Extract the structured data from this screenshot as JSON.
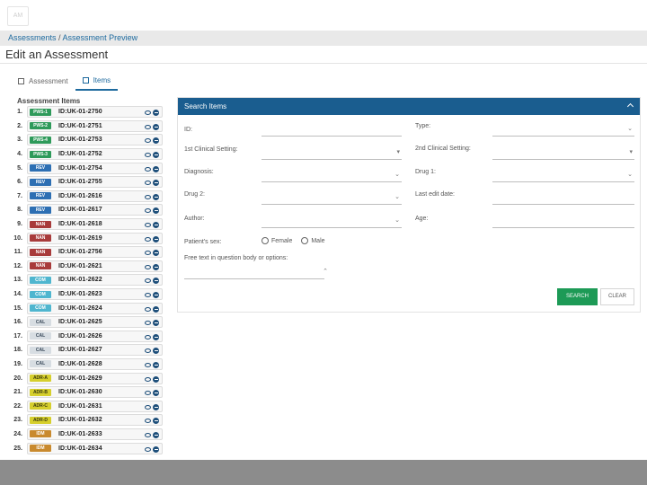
{
  "app": {
    "logo_text": "AM"
  },
  "breadcrumb": {
    "link1": "Assessments",
    "separator": " / ",
    "link2": "Assessment Preview"
  },
  "page": {
    "title": "Edit an Assessment"
  },
  "tabs": [
    {
      "label": "Assessment",
      "active": false
    },
    {
      "label": "Items",
      "active": true
    }
  ],
  "items_header": "Assessment Items",
  "tag_colors": {
    "PWS": "#2e9a5a",
    "REV": "#2d6fb3",
    "NAN": "#a83b3b",
    "COM": "#4fb6cf",
    "CAL": "#d7dde2",
    "ADR": "#d6cf2d",
    "IDM": "#c98a2e"
  },
  "items": [
    {
      "num": "1.",
      "tag": "PWS-1",
      "tag_type": "PWS",
      "id": "ID:UK-01-2750"
    },
    {
      "num": "2.",
      "tag": "PWS-2",
      "tag_type": "PWS",
      "id": "ID:UK-01-2751"
    },
    {
      "num": "3.",
      "tag": "PWS-4",
      "tag_type": "PWS",
      "id": "ID:UK-01-2753"
    },
    {
      "num": "4.",
      "tag": "PWS-3",
      "tag_type": "PWS",
      "id": "ID:UK-01-2752"
    },
    {
      "num": "5.",
      "tag": "REV",
      "tag_type": "REV",
      "id": "ID:UK-01-2754"
    },
    {
      "num": "6.",
      "tag": "REV",
      "tag_type": "REV",
      "id": "ID:UK-01-2755"
    },
    {
      "num": "7.",
      "tag": "REV",
      "tag_type": "REV",
      "id": "ID:UK-01-2616"
    },
    {
      "num": "8.",
      "tag": "REV",
      "tag_type": "REV",
      "id": "ID:UK-01-2617"
    },
    {
      "num": "9.",
      "tag": "NAN",
      "tag_type": "NAN",
      "id": "ID:UK-01-2618"
    },
    {
      "num": "10.",
      "tag": "NAN",
      "tag_type": "NAN",
      "id": "ID:UK-01-2619"
    },
    {
      "num": "11.",
      "tag": "NAN",
      "tag_type": "NAN",
      "id": "ID:UK-01-2756"
    },
    {
      "num": "12.",
      "tag": "NAN",
      "tag_type": "NAN",
      "id": "ID:UK-01-2621"
    },
    {
      "num": "13.",
      "tag": "COM",
      "tag_type": "COM",
      "id": "ID:UK-01-2622"
    },
    {
      "num": "14.",
      "tag": "COM",
      "tag_type": "COM",
      "id": "ID:UK-01-2623"
    },
    {
      "num": "15.",
      "tag": "COM",
      "tag_type": "COM",
      "id": "ID:UK-01-2624"
    },
    {
      "num": "16.",
      "tag": "CAL",
      "tag_type": "CAL",
      "id": "ID:UK-01-2625"
    },
    {
      "num": "17.",
      "tag": "CAL",
      "tag_type": "CAL",
      "id": "ID:UK-01-2626"
    },
    {
      "num": "18.",
      "tag": "CAL",
      "tag_type": "CAL",
      "id": "ID:UK-01-2627"
    },
    {
      "num": "19.",
      "tag": "CAL",
      "tag_type": "CAL",
      "id": "ID:UK-01-2628"
    },
    {
      "num": "20.",
      "tag": "ADR-A",
      "tag_type": "ADR",
      "id": "ID:UK-01-2629"
    },
    {
      "num": "21.",
      "tag": "ADR-B",
      "tag_type": "ADR",
      "id": "ID:UK-01-2630"
    },
    {
      "num": "22.",
      "tag": "ADR-C",
      "tag_type": "ADR",
      "id": "ID:UK-01-2631"
    },
    {
      "num": "23.",
      "tag": "ADR-D",
      "tag_type": "ADR",
      "id": "ID:UK-01-2632"
    },
    {
      "num": "24.",
      "tag": "IDM",
      "tag_type": "IDM",
      "id": "ID:UK-01-2633"
    },
    {
      "num": "25.",
      "tag": "IDM",
      "tag_type": "IDM",
      "id": "ID:UK-01-2634"
    }
  ],
  "search": {
    "title": "Search Items",
    "fields": {
      "id": "ID:",
      "type": "Type:",
      "clinical1": "1st Clinical Setting:",
      "clinical2": "2nd Clinical Setting:",
      "diagnosis": "Diagnosis:",
      "drug1": "Drug 1:",
      "drug2": "Drug 2:",
      "last_edit": "Last edit date:",
      "author": "Author:",
      "age": "Age:",
      "sex": "Patient's sex:",
      "free_text": "Free text in question body or options:"
    },
    "sex_options": {
      "female": "Female",
      "male": "Male"
    },
    "search_button": "SEARCH",
    "clear_button": "CLEAR"
  }
}
